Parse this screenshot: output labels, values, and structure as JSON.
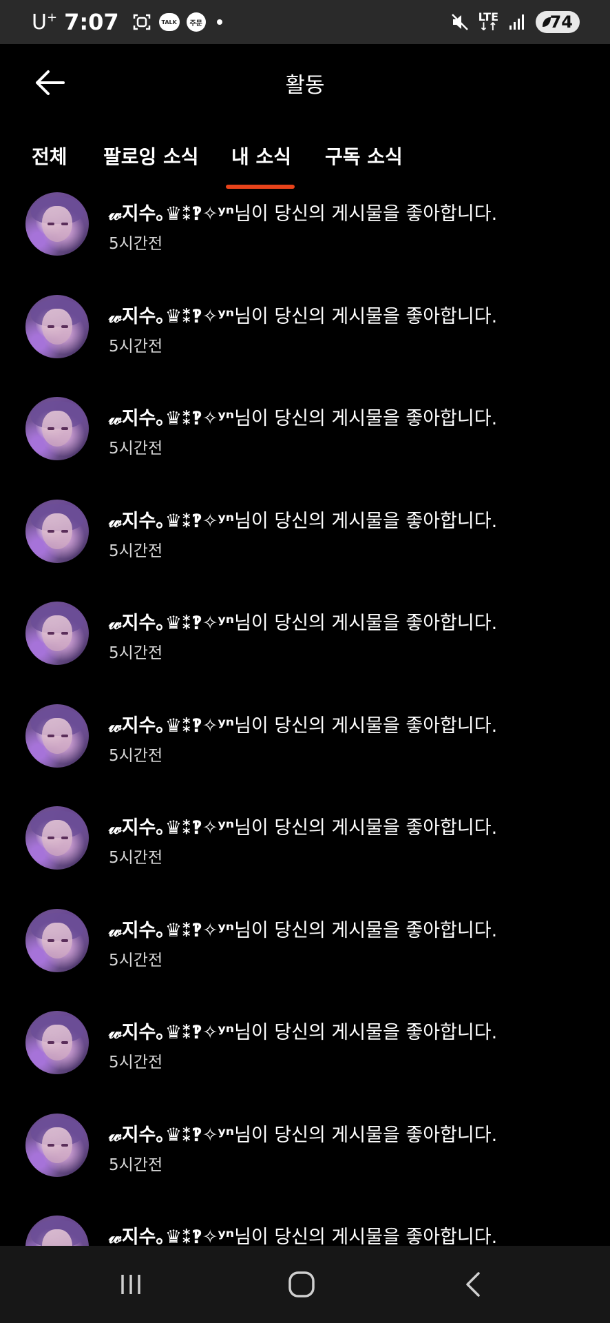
{
  "status_bar": {
    "carrier": "U",
    "carrier_sup": "+",
    "time": "7:07",
    "talk_label": "TALK",
    "order_label": "주문",
    "network": "LTE",
    "battery": "74",
    "icons": [
      "screenshot-icon",
      "kakaotalk-icon",
      "order-icon",
      "dot-icon",
      "mute-icon",
      "lte-icon",
      "signal-icon",
      "battery-icon"
    ]
  },
  "header": {
    "title": "활동",
    "back_icon": "arrow-left-icon"
  },
  "tabs": [
    {
      "label": "전체",
      "active": false
    },
    {
      "label": "팔로잉 소식",
      "active": false
    },
    {
      "label": "내 소식",
      "active": true
    },
    {
      "label": "구독 소식",
      "active": false
    }
  ],
  "accent_color": "#e8431a",
  "notifications": [
    {
      "name": "𝓌지수｡♛⁑‽✧ʸⁿ",
      "message": "님이 당신의 게시물을 좋아합니다.",
      "time": "5시간전"
    },
    {
      "name": "𝓌지수｡♛⁑‽✧ʸⁿ",
      "message": "님이 당신의 게시물을 좋아합니다.",
      "time": "5시간전"
    },
    {
      "name": "𝓌지수｡♛⁑‽✧ʸⁿ",
      "message": "님이 당신의 게시물을 좋아합니다.",
      "time": "5시간전"
    },
    {
      "name": "𝓌지수｡♛⁑‽✧ʸⁿ",
      "message": "님이 당신의 게시물을 좋아합니다.",
      "time": "5시간전"
    },
    {
      "name": "𝓌지수｡♛⁑‽✧ʸⁿ",
      "message": "님이 당신의 게시물을 좋아합니다.",
      "time": "5시간전"
    },
    {
      "name": "𝓌지수｡♛⁑‽✧ʸⁿ",
      "message": "님이 당신의 게시물을 좋아합니다.",
      "time": "5시간전"
    },
    {
      "name": "𝓌지수｡♛⁑‽✧ʸⁿ",
      "message": "님이 당신의 게시물을 좋아합니다.",
      "time": "5시간전"
    },
    {
      "name": "𝓌지수｡♛⁑‽✧ʸⁿ",
      "message": "님이 당신의 게시물을 좋아합니다.",
      "time": "5시간전"
    },
    {
      "name": "𝓌지수｡♛⁑‽✧ʸⁿ",
      "message": "님이 당신의 게시물을 좋아합니다.",
      "time": "5시간전"
    },
    {
      "name": "𝓌지수｡♛⁑‽✧ʸⁿ",
      "message": "님이 당신의 게시물을 좋아합니다.",
      "time": "5시간전"
    },
    {
      "name": "𝓌지수｡♛⁑‽✧ʸⁿ",
      "message": "님이 당신의 게시물을 좋아합니다.",
      "time": ""
    }
  ],
  "nav_bar": {
    "icons": [
      "recent-apps-icon",
      "home-icon",
      "back-icon"
    ]
  }
}
